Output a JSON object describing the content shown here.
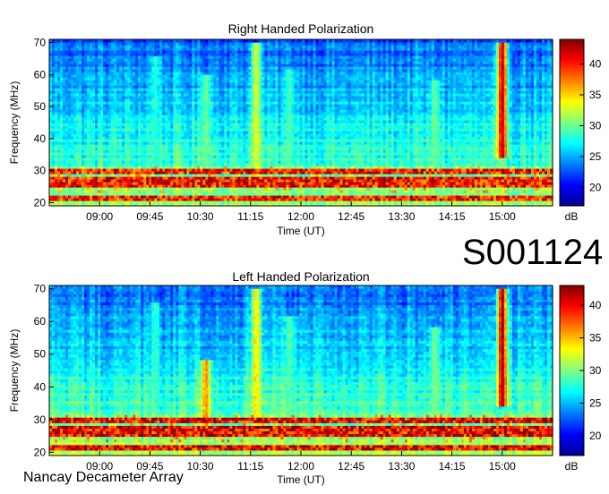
{
  "dataset_id": "S001124",
  "footer_text": "Nancay Decameter Array",
  "colorbar_unit": "dB",
  "chart_data": [
    {
      "type": "heatmap",
      "title": "Right Handed Polarization",
      "xlabel": "Time (UT)",
      "ylabel": "Frequency (MHz)",
      "x_ticks": [
        "09:00",
        "09:45",
        "10:30",
        "11:15",
        "12:00",
        "12:45",
        "13:30",
        "14:15",
        "15:00"
      ],
      "x_range": [
        "08:15",
        "15:45"
      ],
      "y_ticks": [
        20,
        30,
        40,
        50,
        60,
        70
      ],
      "ylim": [
        19,
        71
      ],
      "colorbar": {
        "ticks": [
          20,
          25,
          30,
          35,
          40
        ],
        "range": [
          17,
          44
        ],
        "unit": "dB"
      },
      "features": {
        "background_level_db": 19,
        "rfi_bands_mhz": [
          [
            20.5,
            22.5
          ],
          [
            25,
            28
          ],
          [
            29,
            31
          ]
        ],
        "bursts": [
          {
            "time": "09:50",
            "fmin": 28,
            "fmax": 66,
            "level_db": 28
          },
          {
            "time": "10:35",
            "fmin": 28,
            "fmax": 60,
            "level_db": 30
          },
          {
            "time": "11:20",
            "fmin": 28,
            "fmax": 70,
            "level_db": 33
          },
          {
            "time": "11:50",
            "fmin": 28,
            "fmax": 62,
            "level_db": 29
          },
          {
            "time": "14:00",
            "fmin": 28,
            "fmax": 58,
            "level_db": 30
          },
          {
            "time": "15:00",
            "fmin": 34,
            "fmax": 70,
            "level_db": 42
          }
        ]
      }
    },
    {
      "type": "heatmap",
      "title": "Left Handed Polarization",
      "xlabel": "Time (UT)",
      "ylabel": "Frequency (MHz)",
      "x_ticks": [
        "09:00",
        "09:45",
        "10:30",
        "11:15",
        "12:00",
        "12:45",
        "13:30",
        "14:15",
        "15:00"
      ],
      "x_range": [
        "08:15",
        "15:45"
      ],
      "y_ticks": [
        20,
        30,
        40,
        50,
        60,
        70
      ],
      "ylim": [
        19,
        71
      ],
      "colorbar": {
        "ticks": [
          20,
          25,
          30,
          35,
          40
        ],
        "range": [
          17,
          43
        ],
        "unit": "dB"
      },
      "features": {
        "background_level_db": 19,
        "rfi_bands_mhz": [
          [
            20.5,
            22.5
          ],
          [
            25,
            28
          ],
          [
            29,
            31
          ]
        ],
        "bursts": [
          {
            "time": "09:50",
            "fmin": 28,
            "fmax": 66,
            "level_db": 28
          },
          {
            "time": "10:35",
            "fmin": 28,
            "fmax": 48,
            "level_db": 36
          },
          {
            "time": "11:20",
            "fmin": 28,
            "fmax": 70,
            "level_db": 34
          },
          {
            "time": "11:50",
            "fmin": 28,
            "fmax": 62,
            "level_db": 29
          },
          {
            "time": "14:00",
            "fmin": 28,
            "fmax": 58,
            "level_db": 30
          },
          {
            "time": "15:00",
            "fmin": 34,
            "fmax": 70,
            "level_db": 42
          }
        ]
      }
    }
  ]
}
